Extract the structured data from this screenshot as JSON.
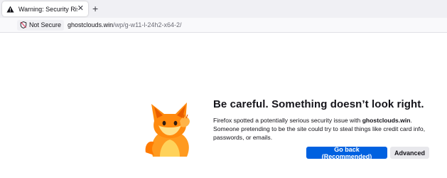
{
  "tab": {
    "title": "Warning: Security Risk",
    "close_icon": "close-icon",
    "warning_icon": "warning-icon"
  },
  "new_tab_glyph": "+",
  "urlbar": {
    "security_label": "Not Secure",
    "security_icon": "shield-slash-icon",
    "host": "ghostclouds.win",
    "path": "/wp/g-w11-l-24h2-x64-2/"
  },
  "error": {
    "heading": "Be careful. Something doesn’t look right.",
    "body_before": "Firefox spotted a potentially serious security issue with ",
    "body_domain": "ghostclouds.win",
    "body_after": ". Someone pretending to be the site could try to steal things like credit card info, passwords, or emails.",
    "go_back_label": "Go back (Recommended)",
    "advanced_label": "Advanced",
    "illustration": "fox-illustration"
  },
  "colors": {
    "primary_button": "#0061e0",
    "secondary_button": "#e8e8ec",
    "tabstrip": "#f0f0f4"
  }
}
